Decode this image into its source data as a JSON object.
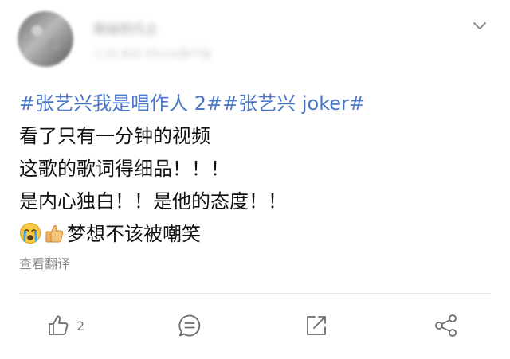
{
  "author": {
    "name": "粉丝的凡士",
    "meta": "2·18 来自 iPhone客户端"
  },
  "post": {
    "tag_1": "#张艺兴我是唱作人 2#",
    "tag_2": "#张艺兴 joker#",
    "line_2": "看了只有一分钟的视频",
    "line_3": "这歌的歌词得细品！！！",
    "line_4": "是内心独白！！是他的态度！！",
    "line_5_text": "梦想不该被嘲笑",
    "emojis": [
      "crying-face",
      "thumbs-up"
    ]
  },
  "translate_label": "查看翻译",
  "actions": {
    "like_count": "2",
    "icons": [
      "like-icon",
      "comment-icon",
      "repost-icon",
      "share-icon"
    ]
  },
  "colors": {
    "hashtag": "#4a77c8",
    "text": "#111111",
    "muted": "#8a8a8a",
    "icon": "#6b6b6b"
  }
}
